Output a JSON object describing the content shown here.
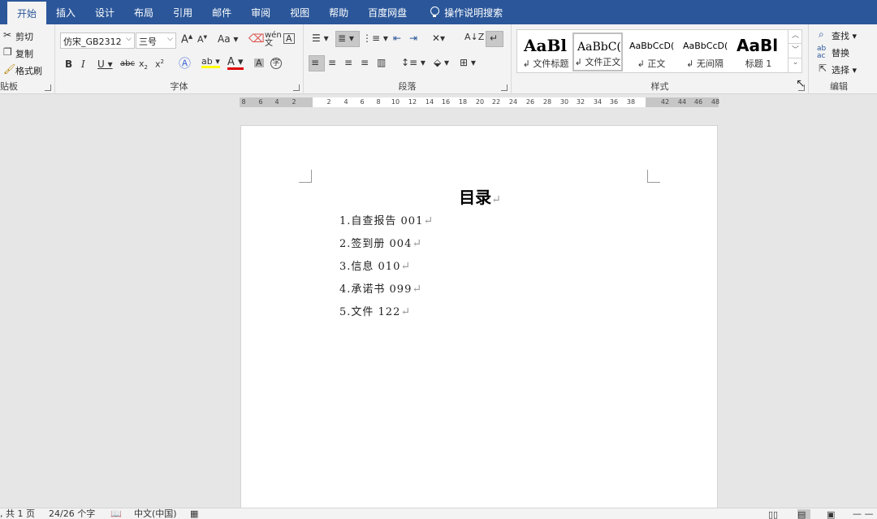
{
  "tabs": [
    {
      "label": "开始",
      "active": true
    },
    {
      "label": "插入"
    },
    {
      "label": "设计"
    },
    {
      "label": "布局"
    },
    {
      "label": "引用"
    },
    {
      "label": "邮件"
    },
    {
      "label": "审阅"
    },
    {
      "label": "视图"
    },
    {
      "label": "帮助"
    },
    {
      "label": "百度网盘"
    }
  ],
  "tell_me": "操作说明搜索",
  "clipboard": {
    "cut": "剪切",
    "copy": "复制",
    "format_painter": "格式刷",
    "label": "贴板"
  },
  "font": {
    "name": "仿宋_GB2312",
    "size": "三号",
    "grow": "A",
    "shrink": "A",
    "case": "Aa",
    "phonetic": "文",
    "label": "字体"
  },
  "paragraph": {
    "label": "段落"
  },
  "styles": {
    "label": "样式",
    "items": [
      {
        "preview": "AaBl",
        "name": "文件标题"
      },
      {
        "preview": "AaBbC(",
        "name": "文件正文"
      },
      {
        "preview": "AaBbCcD(",
        "name": "正文"
      },
      {
        "preview": "AaBbCcD(",
        "name": "无间隔"
      },
      {
        "preview": "AaBl",
        "name": "标题 1"
      }
    ]
  },
  "editing": {
    "find": "查找",
    "replace": "替换",
    "select": "选择",
    "label": "编辑"
  },
  "ruler": {
    "ticks": [
      "8",
      "6",
      "4",
      "2",
      "2",
      "4",
      "6",
      "8",
      "10",
      "12",
      "14",
      "16",
      "18",
      "20",
      "22",
      "24",
      "26",
      "28",
      "30",
      "32",
      "34",
      "36",
      "38",
      "42",
      "44",
      "46",
      "48"
    ]
  },
  "document": {
    "title": "目录",
    "items": [
      "1.自查报告 001",
      "2.签到册 004",
      "3.信息 010",
      "4.承诺书 099",
      "5.文件 122"
    ],
    "paragraph_mark": "↵"
  },
  "status": {
    "page": ", 共 1 页",
    "words": "24/26 个字",
    "language": "中文(中国)"
  },
  "colors": {
    "accent": "#2b579a",
    "ribbon": "#f3f3f3",
    "canvas": "#e6e6e6"
  }
}
